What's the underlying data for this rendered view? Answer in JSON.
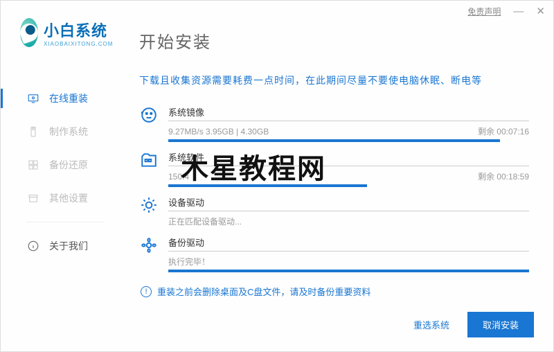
{
  "titlebar": {
    "disclaimer": "免责声明"
  },
  "logo": {
    "cn": "小白系统",
    "en": "XIAOBAIXITONG.COM"
  },
  "sidebar": {
    "items": [
      {
        "label": "在线重装"
      },
      {
        "label": "制作系统"
      },
      {
        "label": "备份还原"
      },
      {
        "label": "其他设置"
      },
      {
        "label": "关于我们"
      }
    ]
  },
  "page": {
    "title": "开始安装",
    "note": "下载且收集资源需要耗费一点时间，在此期间尽量不要使电脑休眠、断电等"
  },
  "tasks": [
    {
      "title": "系统镜像",
      "stats": "9.27MB/s 3.95GB | 4.30GB",
      "remain": "剩余 00:07:16",
      "progress": 92
    },
    {
      "title": "系统软件",
      "stats": "150.4",
      "remain": "剩余 00:18:59",
      "progress": 55
    },
    {
      "title": "设备驱动",
      "stats": "正在匹配设备驱动...",
      "remain": "",
      "progress": 0
    },
    {
      "title": "备份驱动",
      "stats": "执行完毕！",
      "remain": "",
      "progress": 100
    }
  ],
  "warning": "重装之前会删除桌面及C盘文件，请及时备份重要资料",
  "footer": {
    "reselect": "重选系统",
    "cancel": "取消安装"
  },
  "watermark": "木星教程网"
}
